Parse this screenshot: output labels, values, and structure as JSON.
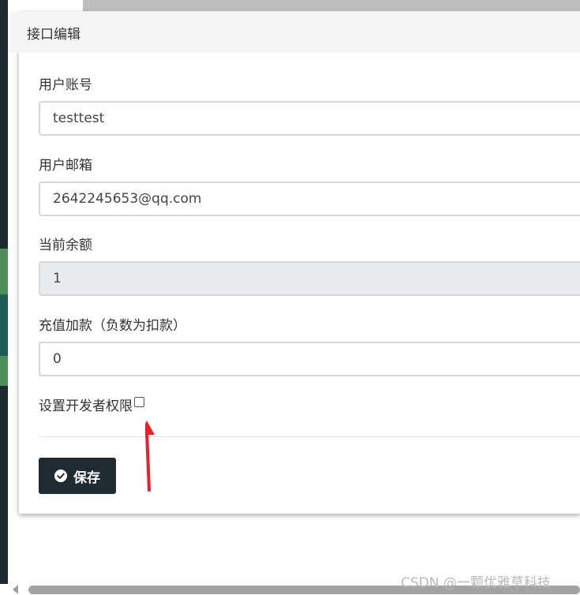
{
  "modal": {
    "title": "接口编辑"
  },
  "form": {
    "account": {
      "label": "用户账号",
      "value": "testtest"
    },
    "email": {
      "label": "用户邮箱",
      "value": "2642245653@qq.com"
    },
    "balance": {
      "label": "当前余额",
      "value": "1"
    },
    "recharge": {
      "label": "充值加款（负数为扣款）",
      "value": "0"
    },
    "developer": {
      "label": "设置开发者权限",
      "checked": false
    },
    "save_label": "保存"
  },
  "watermark": "CSDN @一颗优雅草科技",
  "colors": {
    "button": "#1f2b30",
    "annotation_arrow": "#e8202a",
    "readonly_bg": "#e9ecef"
  }
}
